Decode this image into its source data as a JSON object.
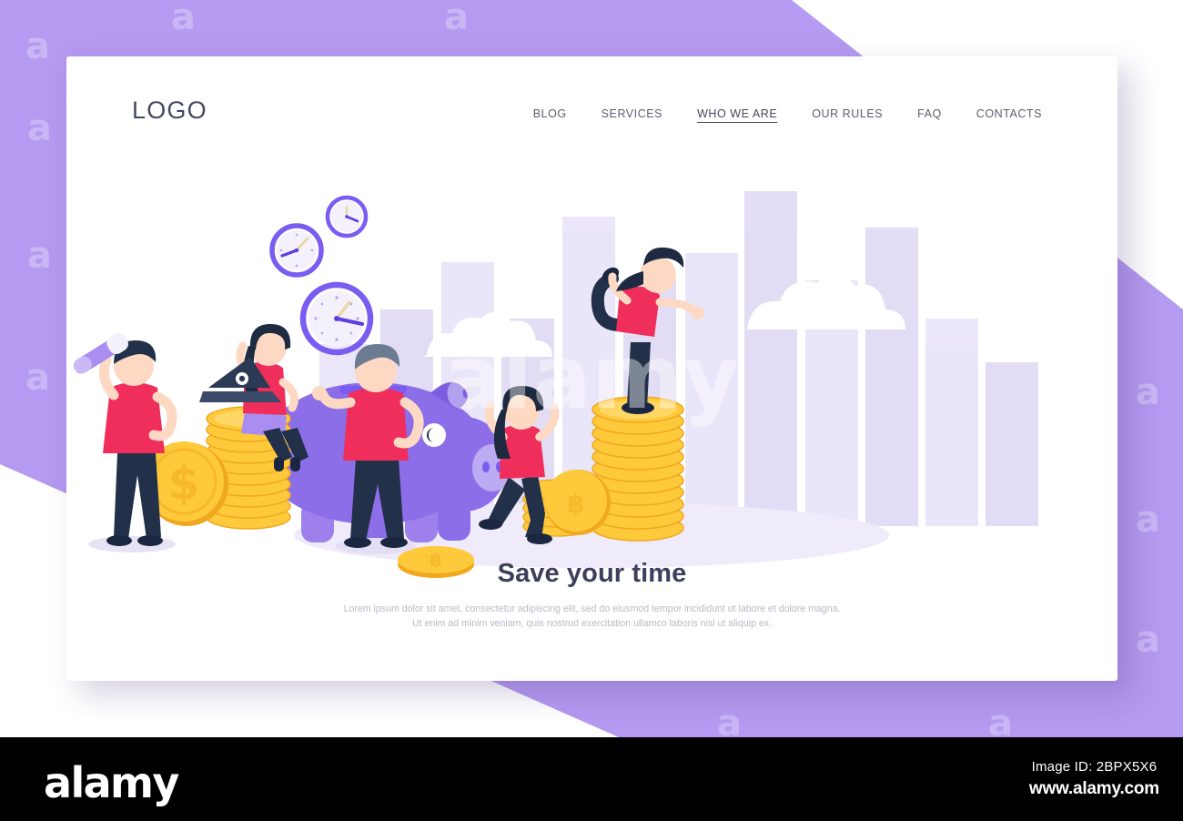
{
  "page": {
    "bg_color": "#b49af0",
    "card_bg": "#ffffff"
  },
  "header": {
    "logo": "LOGO",
    "nav": [
      {
        "label": "BLOG",
        "active": false
      },
      {
        "label": "SERVICES",
        "active": false
      },
      {
        "label": "WHO WE ARE",
        "active": true
      },
      {
        "label": "OUR RULES",
        "active": false
      },
      {
        "label": "FAQ",
        "active": false
      },
      {
        "label": "CONTACTS",
        "active": false
      }
    ]
  },
  "hero": {
    "title": "Save your time",
    "paragraph_line1": "Lorem ipsum dolor sit amet, consectetur adipiscing elit, sed do eiusmod tempor incididunt ut labore et dolore magna.",
    "paragraph_line2": "Ut enim ad minim veniam, quis nostrud exercitation ullamco laboris nisi ut aliquip ex."
  },
  "illustration": {
    "alt": "flat illustration: people around a purple piggy bank with gold coin stacks and floating clocks",
    "colors": {
      "piggy": "#8b6ee8",
      "piggy_light": "#a98df0",
      "coin": "#ffc93c",
      "coin_dark": "#f0a81e",
      "shirt_red": "#ef2e5b",
      "pants_navy": "#22304a",
      "skin": "#fdd9c4",
      "hair_dark": "#1d2a3f",
      "clock_rim": "#7a5cf0",
      "bars": "#e6e1f7",
      "cloud": "#ffffff",
      "ground": "#efebfa"
    },
    "elements": [
      "bar-chart-backdrop",
      "clouds",
      "clock-small",
      "clock-medium",
      "clock-large",
      "piggy-bank",
      "coin-stack-left",
      "coin-stack-right",
      "dollar-coin",
      "bitcoin-coin",
      "man-with-telescope",
      "woman-with-laptop",
      "man-presenting",
      "woman-cheering",
      "woman-yoga-pose"
    ]
  },
  "watermark": {
    "brand": "alamy",
    "image_id": "Image ID: 2BPX5X6",
    "url": "www.alamy.com",
    "tile_text": "a",
    "tile_text_long": "alamy"
  }
}
